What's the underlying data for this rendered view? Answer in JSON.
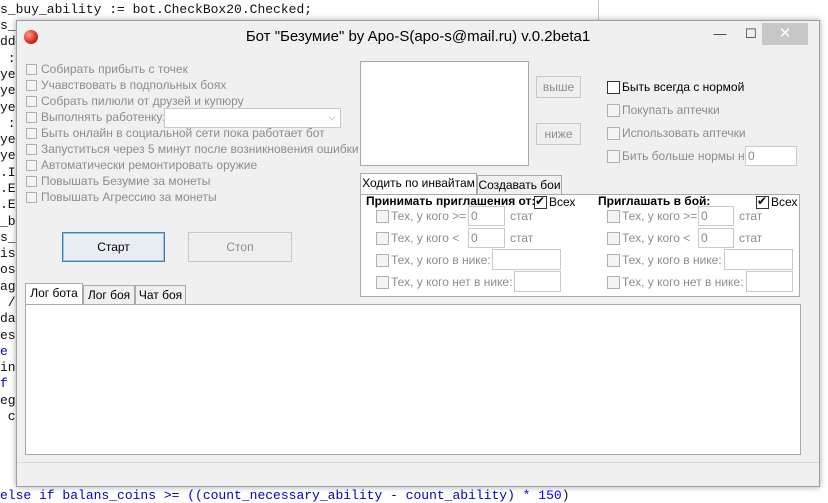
{
  "code_lines": [
    {
      "text": "s_buy_ability := bot.CheckBox20.Checked;"
    },
    {
      "text": "s_"
    },
    {
      "text": "dd"
    },
    {
      "text": " :"
    },
    {
      "text": "ye"
    },
    {
      "text": "ye"
    },
    {
      "text": "ye"
    },
    {
      "text": " :"
    },
    {
      "text": "ye"
    },
    {
      "text": "ye"
    },
    {
      "text": ".I"
    },
    {
      "text": ".E"
    },
    {
      "text": ".E"
    },
    {
      "text": "_b"
    },
    {
      "text": "s_"
    },
    {
      "text": "is"
    },
    {
      "text": "os"
    },
    {
      "text": "ag"
    },
    {
      "text": " /"
    },
    {
      "text": "da"
    },
    {
      "text": "es"
    },
    {
      "text": "e"
    },
    {
      "text": "in"
    },
    {
      "text": "f"
    },
    {
      "text": "eg"
    },
    {
      "text": " c"
    }
  ],
  "code_bottom": {
    "prefix": "else if balans_coins >= ((count_necessary_ability - count_ability) * ",
    "number": "150",
    "suffix": ")"
  },
  "code_mid": {
    "text": "  i"
  },
  "window": {
    "title": "Бот \"Безумие\" by Apo-S(apo-s@mail.ru) v.0.2beta1",
    "min_glyph": "—",
    "max_glyph": "☐",
    "close_glyph": "✕"
  },
  "left_options": [
    {
      "label": "Собирать прибыть с точек"
    },
    {
      "label": "Учавствовать в подпольных боях"
    },
    {
      "label": "Собрать пилюли от друзей и купюру"
    },
    {
      "label": "Выполнять работенку:"
    },
    {
      "label": "Быть онлайн в социальной сети пока работает бот"
    },
    {
      "label": "Запуститься через 5 минут после возникновения ошибки"
    },
    {
      "label": "Автоматически ремонтировать оружие"
    },
    {
      "label": "Повышать Безумие за монеты"
    },
    {
      "label": "Повышать Агрессию за монеты"
    }
  ],
  "job_dropdown": {
    "value": ""
  },
  "buttons": {
    "start": "Старт",
    "stop": "Стоп",
    "up": "выше",
    "down": "ниже"
  },
  "right_options": {
    "always_normal": "Быть всегда с нормой",
    "buy_meds": "Покупать аптечки",
    "use_meds": "Использовать аптечки",
    "beat_more": "Бить больше нормы на:",
    "beat_more_value": "0"
  },
  "invite_tabs": [
    "Ходить по инвайтам",
    "Создавать бои"
  ],
  "accept": {
    "heading": "Принимать приглашения от:",
    "all": "Всех",
    "ge_label": "Тех, у кого >=",
    "ge_value": "0",
    "lt_label": "Тех, у кого <",
    "lt_value": "0",
    "stat": "стат",
    "in_nick": "Тех, у кого в нике:",
    "not_in_nick": "Тех, у кого нет в нике:"
  },
  "invite": {
    "heading": "Приглашать в бой:",
    "all": "Всех",
    "ge_label": "Тех, у кого >=",
    "ge_value": "0",
    "lt_label": "Тех, у кого <",
    "lt_value": "0",
    "stat": "стат",
    "in_nick": "Тех, у кого в нике:",
    "not_in_nick": "Тех, у кого нет в нике:"
  },
  "log_tabs": [
    "Лог бота",
    "Лог боя",
    "Чат боя"
  ]
}
